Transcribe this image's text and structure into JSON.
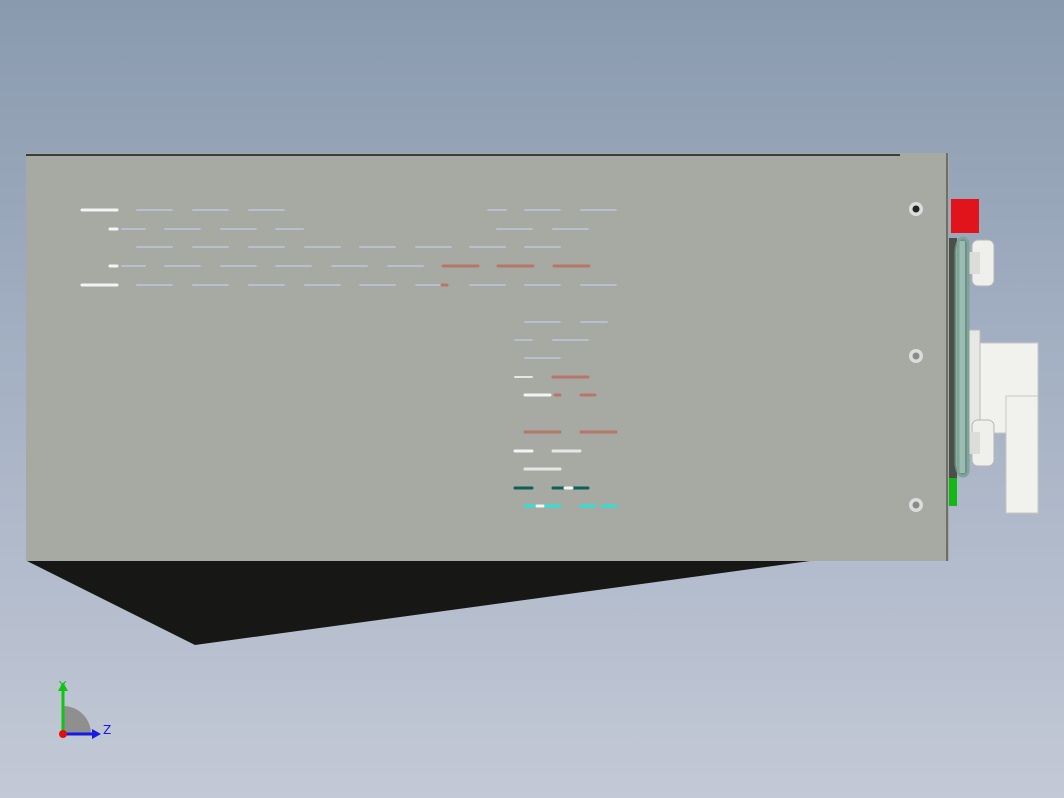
{
  "viewport": {
    "background_top": "#8a9aae",
    "background_bottom": "#c3c9d6",
    "panel_color": "#a6aaa2",
    "shadow_color": "#171816"
  },
  "parts": {
    "red_block": {
      "color": "#e0141a"
    },
    "green_block": {
      "color": "#14b814"
    },
    "handle": {
      "color": "#9bbcb2"
    },
    "connectors": {
      "color": "#f1f1ee"
    }
  },
  "mounting_holes": [
    "screw-hole-top",
    "screw-hole-middle",
    "screw-hole-bottom"
  ],
  "triad": {
    "y_label": "Y",
    "z_label": "Z",
    "y_color": "#13c313",
    "z_color": "#1919e6",
    "x_color": "#e01010"
  }
}
